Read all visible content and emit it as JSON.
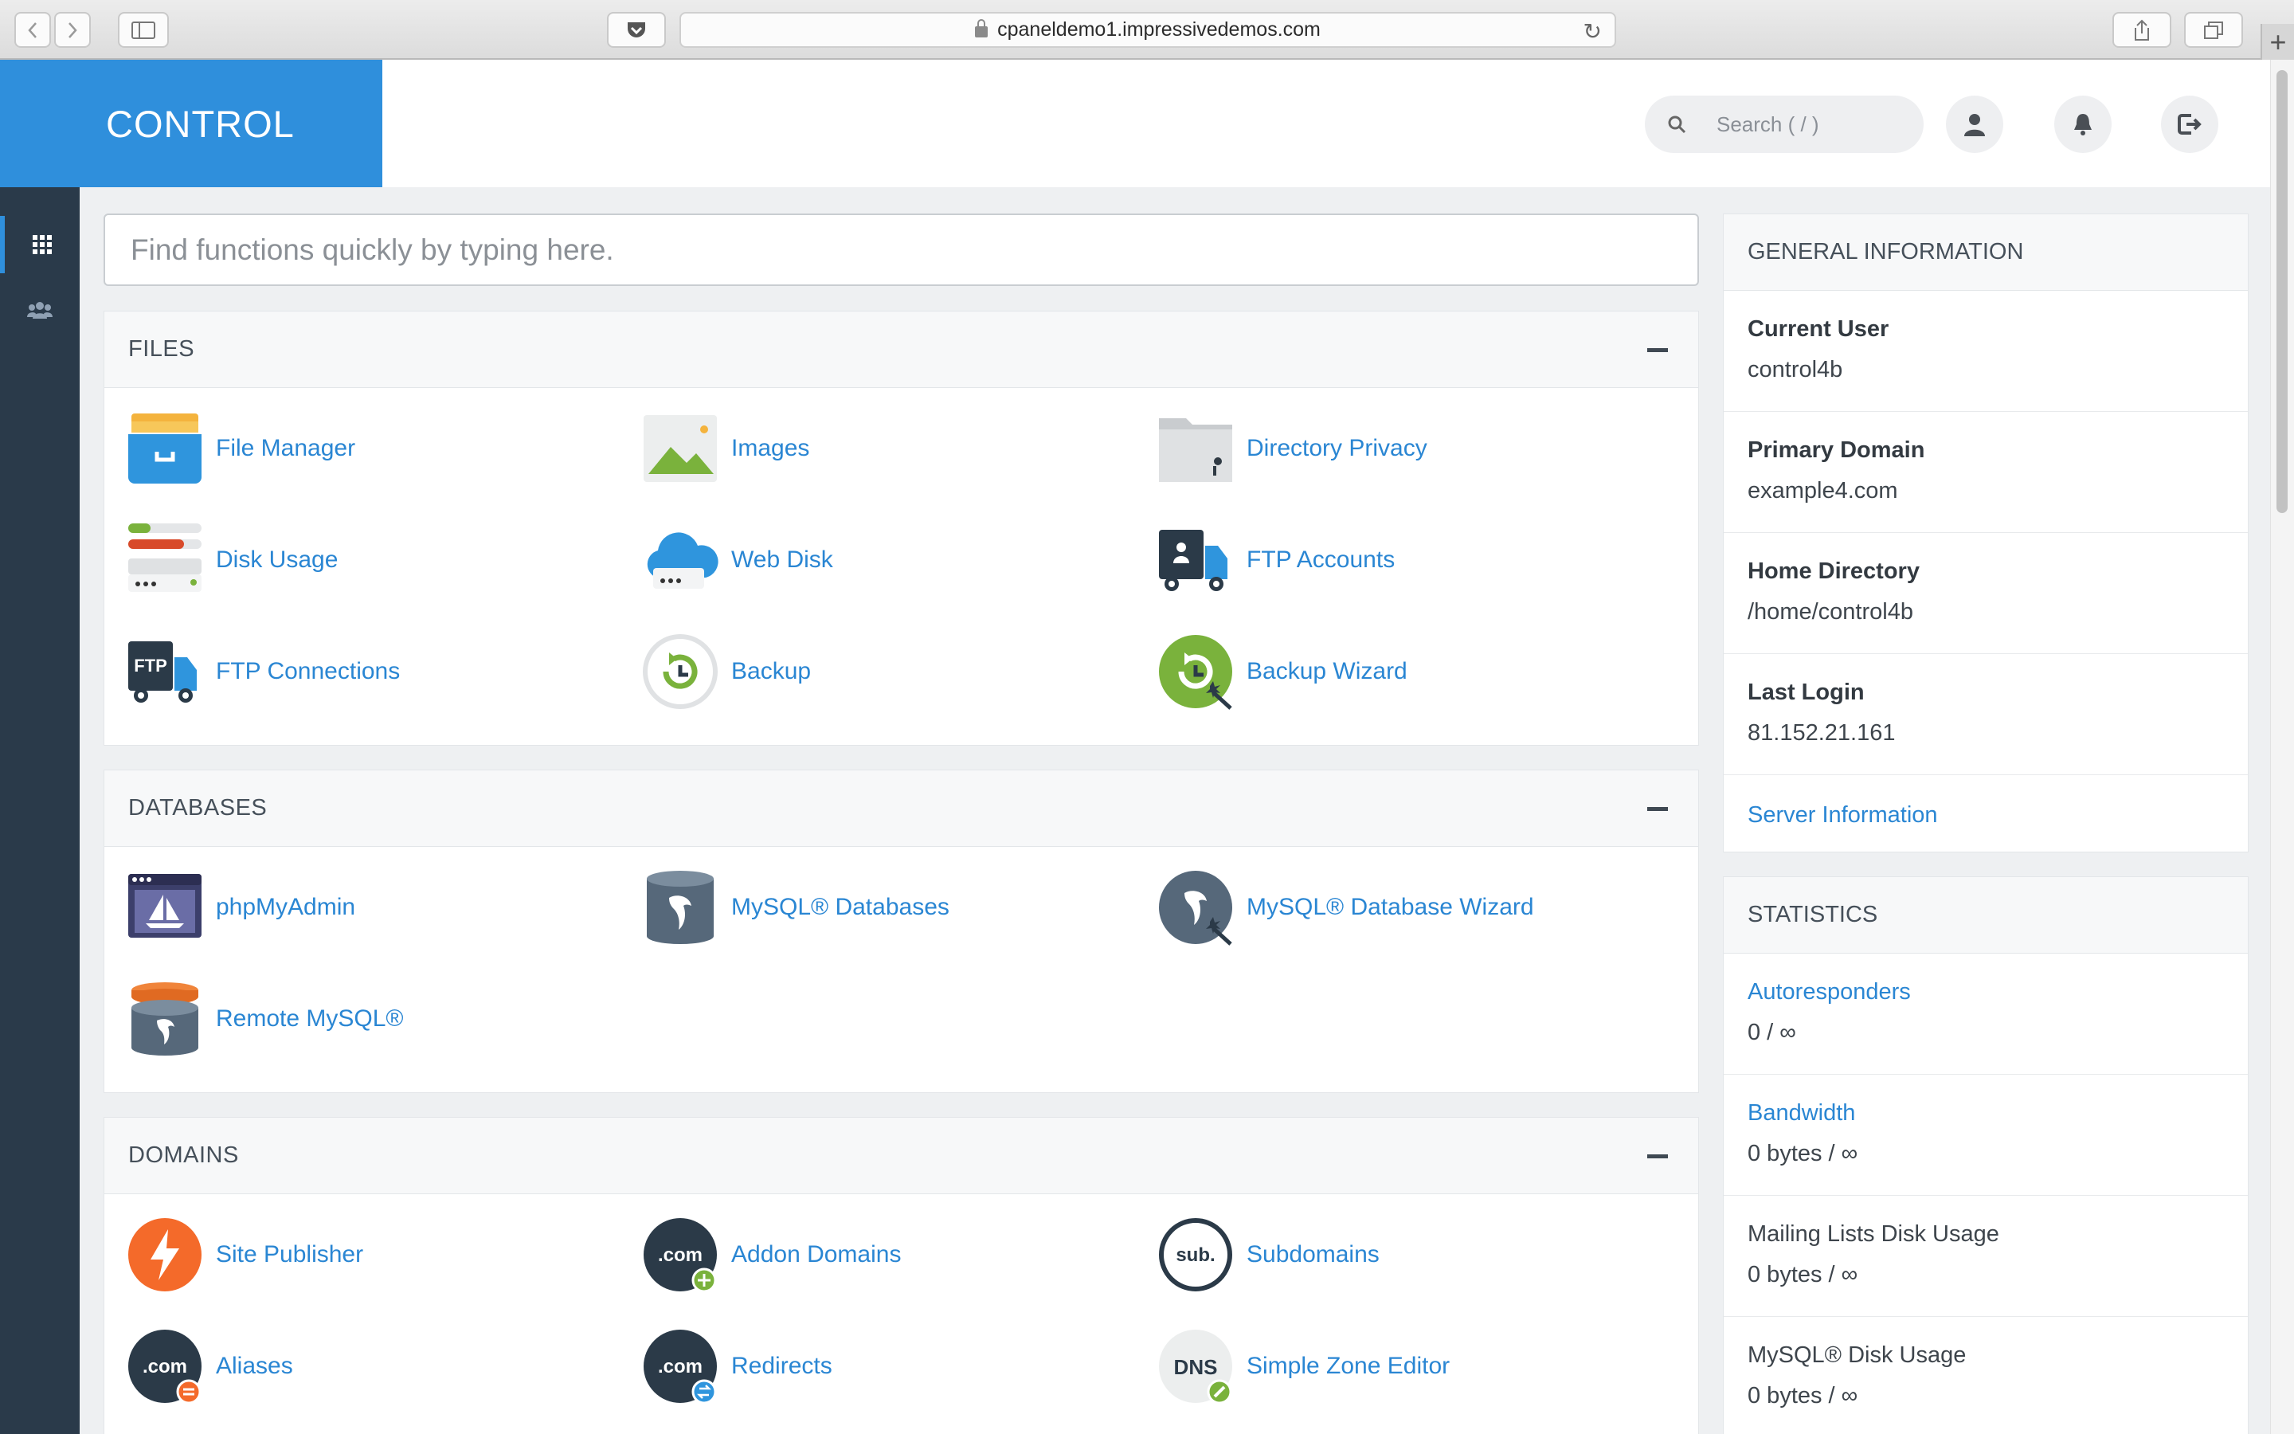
{
  "browser": {
    "url": "cpaneldemo1.impressivedemos.com"
  },
  "header": {
    "brand": "CONTROL",
    "search_placeholder": "Search ( / )"
  },
  "quickfind": {
    "placeholder": "Find functions quickly by typing here."
  },
  "sections": {
    "files": {
      "title": "FILES",
      "items": [
        "File Manager",
        "Images",
        "Directory Privacy",
        "Disk Usage",
        "Web Disk",
        "FTP Accounts",
        "FTP Connections",
        "Backup",
        "Backup Wizard"
      ]
    },
    "databases": {
      "title": "DATABASES",
      "items": [
        "phpMyAdmin",
        "MySQL® Databases",
        "MySQL® Database Wizard",
        "Remote MySQL®"
      ]
    },
    "domains": {
      "title": "DOMAINS",
      "items": [
        "Site Publisher",
        "Addon Domains",
        "Subdomains",
        "Aliases",
        "Redirects",
        "Simple Zone Editor"
      ]
    }
  },
  "general_info": {
    "title": "GENERAL INFORMATION",
    "rows": [
      {
        "label": "Current User",
        "value": "control4b"
      },
      {
        "label": "Primary Domain",
        "value": "example4.com"
      },
      {
        "label": "Home Directory",
        "value": "/home/control4b"
      },
      {
        "label": "Last Login",
        "value": "81.152.21.161"
      }
    ],
    "server_link": "Server Information"
  },
  "statistics": {
    "title": "STATISTICS",
    "rows": [
      {
        "label": "Autoresponders",
        "value": "0 / ∞"
      },
      {
        "label": "Bandwidth",
        "value": "0 bytes / ∞"
      },
      {
        "label": "Mailing Lists Disk Usage",
        "value": "0 bytes / ∞"
      },
      {
        "label": "MySQL® Disk Usage",
        "value": "0 bytes / ∞"
      }
    ]
  },
  "icon_text": {
    "ftp": "FTP",
    "dotcom": ".com",
    "sub": "sub.",
    "dns": "DNS"
  },
  "colors": {
    "brand": "#2f8fdc",
    "sidebar": "#2a3a4a",
    "link": "#2a86d3"
  }
}
